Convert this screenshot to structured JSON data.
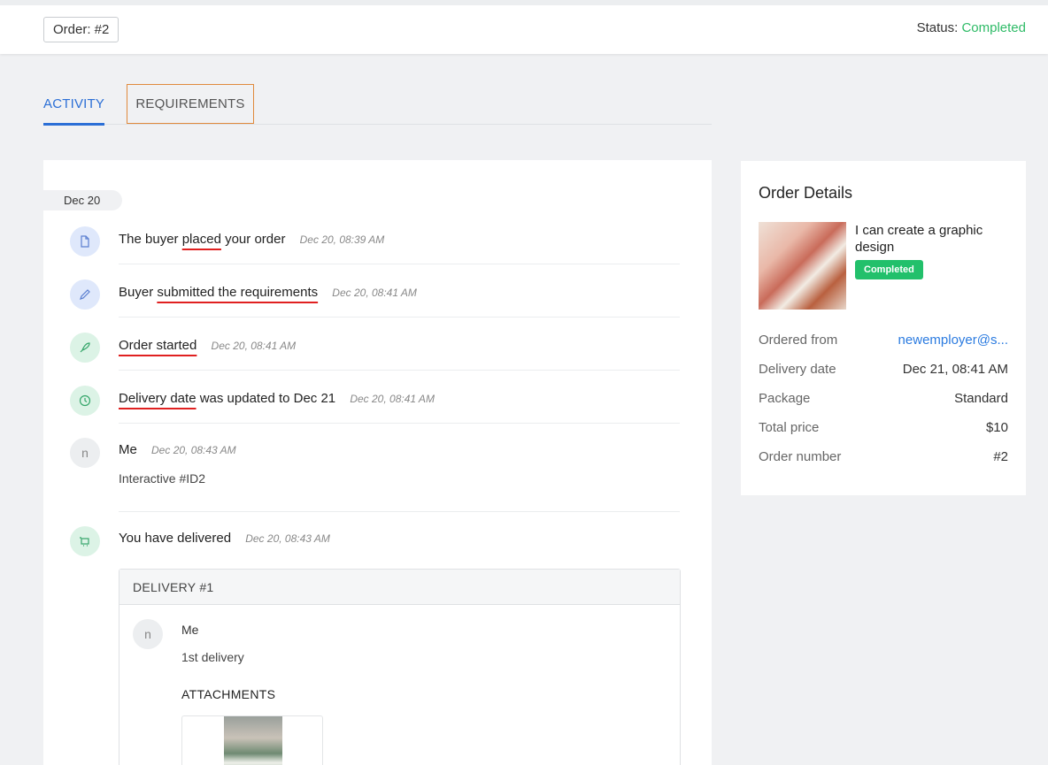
{
  "header": {
    "order_label": "Order: #2",
    "status_label": "Status:",
    "status_value": "Completed"
  },
  "tabs": [
    {
      "label": "ACTIVITY"
    },
    {
      "label": "REQUIREMENTS"
    }
  ],
  "timeline": {
    "date_group": "Dec 20",
    "events": [
      {
        "pre": "The buyer",
        "underlined": "placed",
        "post": "your order",
        "time": "Dec 20, 08:39 AM",
        "icon": "document-icon"
      },
      {
        "pre": "Buyer",
        "underlined": "submitted the requirements",
        "post": "",
        "time": "Dec 20, 08:41 AM",
        "icon": "pencil-icon"
      },
      {
        "pre": "",
        "underlined": "Order started",
        "post": "",
        "time": "Dec 20, 08:41 AM",
        "icon": "rocket-icon"
      },
      {
        "pre": "",
        "underlined": "Delivery date",
        "post": "was updated to Dec 21",
        "time": "Dec 20, 08:41 AM",
        "icon": "clock-icon"
      }
    ],
    "message": {
      "avatar": "n",
      "sender": "Me",
      "time": "Dec 20, 08:43 AM",
      "body": "Interactive #ID2"
    },
    "delivered": {
      "text": "You have delivered",
      "time": "Dec 20, 08:43 AM",
      "icon": "delivery-truck-icon"
    }
  },
  "delivery": {
    "title": "DELIVERY #1",
    "avatar": "n",
    "sender": "Me",
    "note": "1st delivery",
    "attachments_label": "ATTACHMENTS"
  },
  "order_details": {
    "title": "Order Details",
    "gig_title": "I can create a graphic design",
    "badge": "Completed",
    "rows": [
      {
        "label": "Ordered from",
        "value": "newemployer@s..."
      },
      {
        "label": "Delivery date",
        "value": "Dec 21, 08:41 AM"
      },
      {
        "label": "Package",
        "value": "Standard"
      },
      {
        "label": "Total price",
        "value": "$10"
      },
      {
        "label": "Order number",
        "value": "#2"
      }
    ]
  },
  "colors": {
    "accent": "#2b6fd6",
    "success": "#22c06b",
    "highlight_border": "#e08a3c",
    "annotation_underline": "#e02020"
  }
}
